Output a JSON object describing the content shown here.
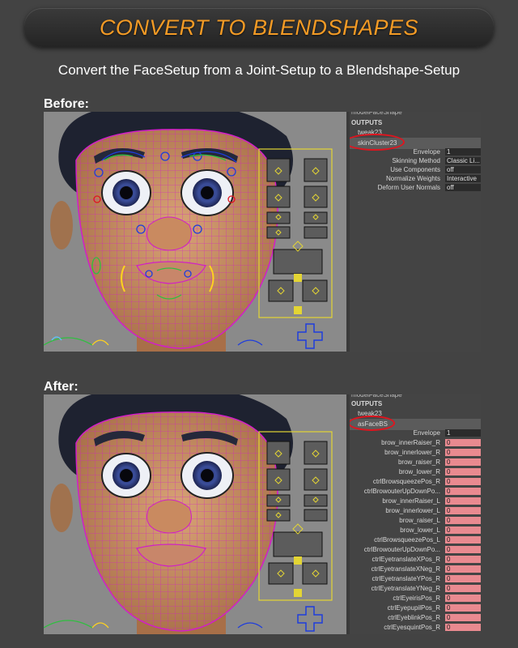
{
  "header": {
    "title": "CONVERT TO BLENDSHAPES",
    "subtitle": "Convert the FaceSetup from a Joint-Setup to a Blendshape-Setup"
  },
  "colors": {
    "accent": "#f29a25",
    "highlight_oval": "#e0141e",
    "attr_pink": "#e98a90",
    "wire": "#d21ec8"
  },
  "before": {
    "label": "Before:",
    "channel_box": {
      "truncated_top": "modelFaceShape",
      "outputs": "OUTPUTS",
      "nodes": [
        "tweak23",
        "skinCluster23"
      ],
      "selected_node": "skinCluster23",
      "attributes": [
        {
          "name": "Envelope",
          "value": "1"
        },
        {
          "name": "Skinning Method",
          "value": "Classic Li..."
        },
        {
          "name": "Use Components",
          "value": "off"
        },
        {
          "name": "Normalize Weights",
          "value": "Interactive"
        },
        {
          "name": "Deform User Normals",
          "value": "off"
        }
      ]
    }
  },
  "after": {
    "label": "After:",
    "channel_box": {
      "truncated_top": "modelFaceShape",
      "outputs": "OUTPUTS",
      "nodes": [
        "tweak23",
        "asFaceBS"
      ],
      "selected_node": "asFaceBS",
      "envelope": {
        "name": "Envelope",
        "value": "1"
      },
      "attributes": [
        {
          "name": "brow_innerRaiser_R",
          "value": "0"
        },
        {
          "name": "brow_innerlower_R",
          "value": "0"
        },
        {
          "name": "brow_raiser_R",
          "value": "0"
        },
        {
          "name": "brow_lower_R",
          "value": "0"
        },
        {
          "name": "ctrlBrowsqueezePos_R",
          "value": "0"
        },
        {
          "name": "ctrlBrowouterUpDownPo...",
          "value": "0"
        },
        {
          "name": "brow_innerRaiser_L",
          "value": "0"
        },
        {
          "name": "brow_innerlower_L",
          "value": "0"
        },
        {
          "name": "brow_raiser_L",
          "value": "0"
        },
        {
          "name": "brow_lower_L",
          "value": "0"
        },
        {
          "name": "ctrlBrowsqueezePos_L",
          "value": "0"
        },
        {
          "name": "ctrlBrowouterUpDownPo...",
          "value": "0"
        },
        {
          "name": "ctrlEyetranslateXPos_R",
          "value": "0"
        },
        {
          "name": "ctrlEyetranslateXNeg_R",
          "value": "0"
        },
        {
          "name": "ctrlEyetranslateYPos_R",
          "value": "0"
        },
        {
          "name": "ctrlEyetranslateYNeg_R",
          "value": "0"
        },
        {
          "name": "ctrlEyeirisPos_R",
          "value": "0"
        },
        {
          "name": "ctrlEyepupilPos_R",
          "value": "0"
        },
        {
          "name": "ctrlEyeblinkPos_R",
          "value": "0"
        },
        {
          "name": "ctrlEyesquintPos_R",
          "value": "0"
        }
      ]
    }
  }
}
